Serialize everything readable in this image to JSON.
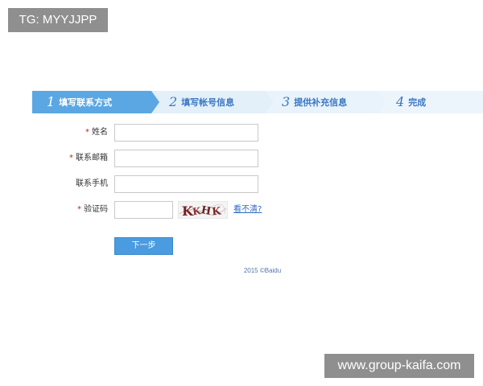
{
  "watermarks": {
    "top_left": "TG: MYYJJPP",
    "bottom_right": "www.group-kaifa.com"
  },
  "steps": [
    {
      "num": "1",
      "label": "填写联系方式",
      "active": true
    },
    {
      "num": "2",
      "label": "填写帐号信息",
      "active": false
    },
    {
      "num": "3",
      "label": "提供补充信息",
      "active": false
    },
    {
      "num": "4",
      "label": "完成",
      "active": false
    }
  ],
  "form": {
    "required_mark": "*",
    "name": {
      "label": "姓名",
      "value": "",
      "required": true
    },
    "email": {
      "label": "联系邮箱",
      "value": "",
      "required": true
    },
    "phone": {
      "label": "联系手机",
      "value": "",
      "required": false
    },
    "captcha": {
      "label": "验证码",
      "value": "",
      "required": true,
      "image_text": "KKHK"
    },
    "refresh_link": "看不清?"
  },
  "next_button": "下一步",
  "footer": "2015 ©Baidu",
  "colors": {
    "active_step": "#5ba7e3",
    "inactive_step": "#e3f0fa",
    "step_text": "#3b78c4",
    "button": "#4b9be0",
    "required": "#cc2222",
    "link": "#2f6bc2"
  }
}
